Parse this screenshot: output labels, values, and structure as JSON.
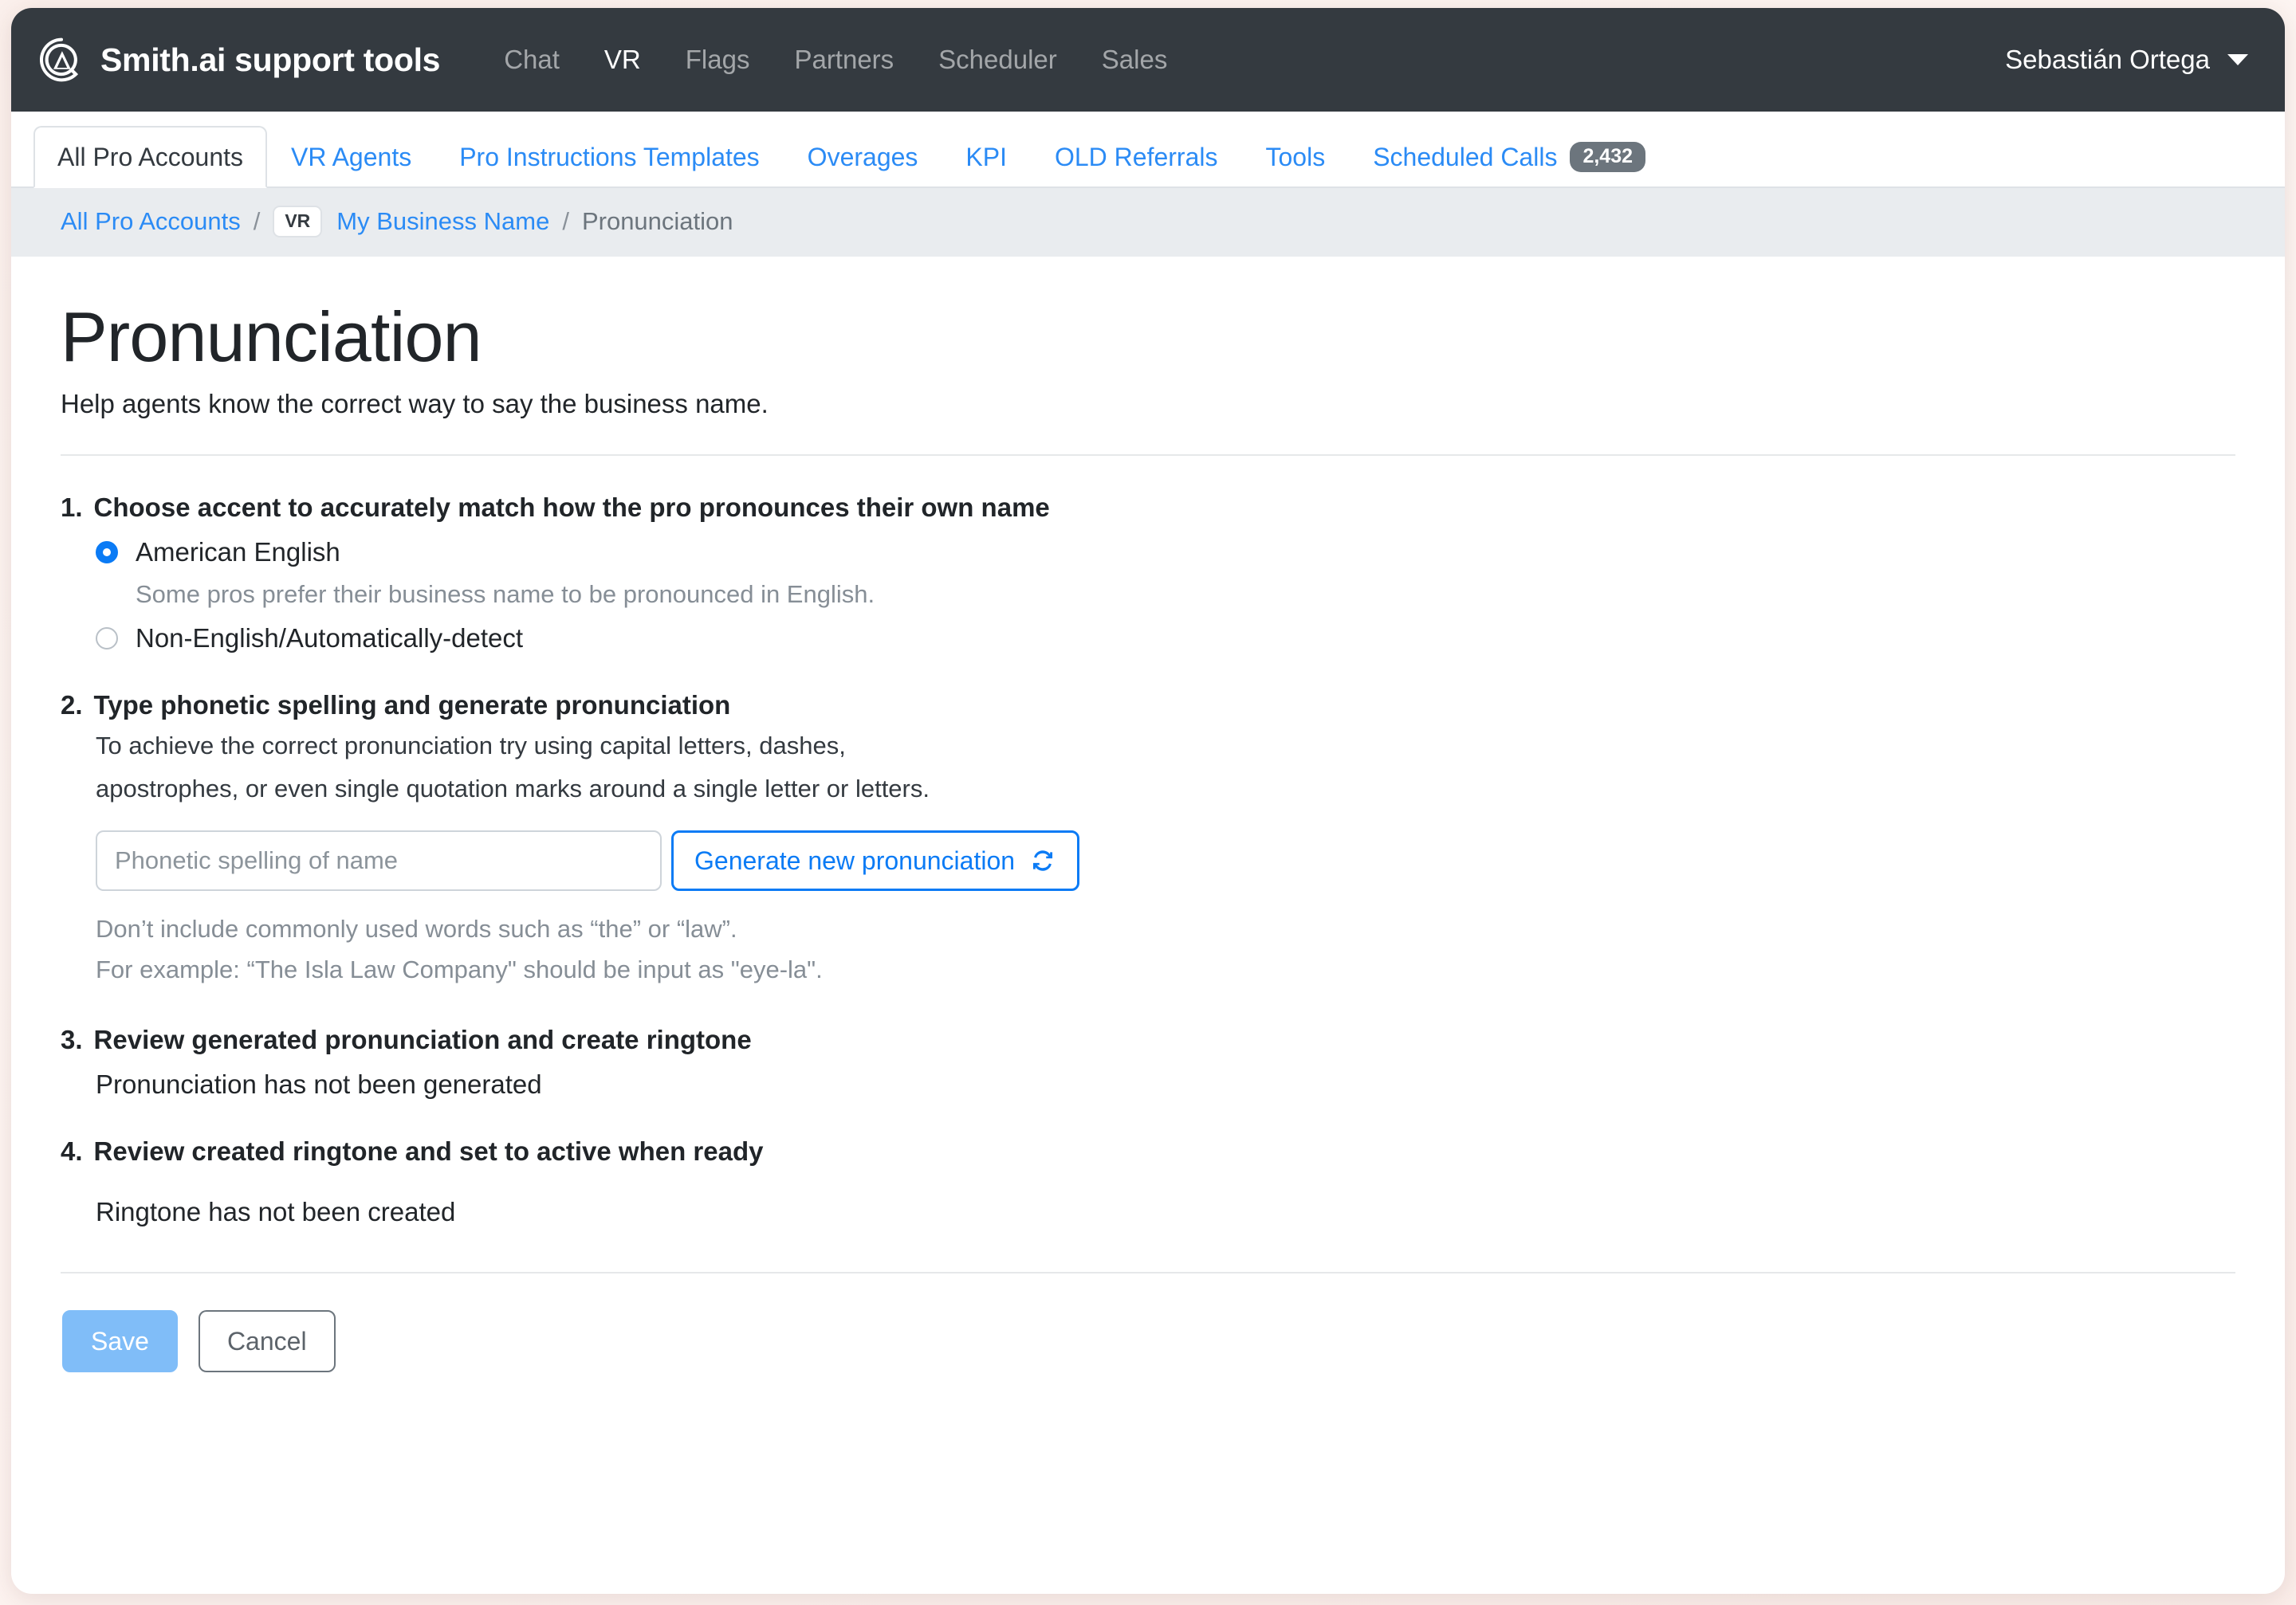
{
  "navbar": {
    "brand": "Smith.ai support tools",
    "logo_icon": "smith-ai-logo-icon",
    "links": [
      {
        "label": "Chat",
        "active": false
      },
      {
        "label": "VR",
        "active": true
      },
      {
        "label": "Flags",
        "active": false
      },
      {
        "label": "Partners",
        "active": false
      },
      {
        "label": "Scheduler",
        "active": false
      },
      {
        "label": "Sales",
        "active": false
      }
    ],
    "user": "Sebastián Ortega",
    "caret_icon": "chevron-down-icon"
  },
  "tabs": [
    {
      "label": "All Pro Accounts",
      "active": true,
      "badge": ""
    },
    {
      "label": "VR Agents",
      "active": false,
      "badge": ""
    },
    {
      "label": "Pro Instructions Templates",
      "active": false,
      "badge": ""
    },
    {
      "label": "Overages",
      "active": false,
      "badge": ""
    },
    {
      "label": "KPI",
      "active": false,
      "badge": ""
    },
    {
      "label": "OLD Referrals",
      "active": false,
      "badge": ""
    },
    {
      "label": "Tools",
      "active": false,
      "badge": ""
    },
    {
      "label": "Scheduled Calls",
      "active": false,
      "badge": "2,432"
    }
  ],
  "breadcrumb": {
    "root": "All Pro Accounts",
    "sep": "/",
    "chip": "VR",
    "business": "My Business Name",
    "current": "Pronunciation"
  },
  "page": {
    "title": "Pronunciation",
    "subtitle": "Help agents know the correct way to say the business name."
  },
  "steps": {
    "one": {
      "num": "1.",
      "title": "Choose accent to accurately match how the pro pronounces their own name",
      "options": [
        {
          "label": "American English",
          "selected": true,
          "help": "Some pros prefer their business name to be pronounced in English."
        },
        {
          "label": "Non-English/Automatically-detect",
          "selected": false,
          "help": ""
        }
      ]
    },
    "two": {
      "num": "2.",
      "title": "Type phonetic spelling and generate pronunciation",
      "body_line1": "To achieve the correct pronunciation try using capital letters, dashes,",
      "body_line2": "apostrophes, or even single quotation marks around a single letter or letters.",
      "input_placeholder": "Phonetic spelling of name",
      "input_value": "",
      "generate_label": "Generate new pronunciation",
      "generate_icon": "sync-refresh-icon",
      "hint_line1": "Don’t include commonly used words such as “the” or “law”.",
      "hint_line2": "For example: “The Isla Law Company\" should be input as \"eye-la\"."
    },
    "three": {
      "num": "3.",
      "title": "Review generated pronunciation and create ringtone",
      "status": "Pronunciation has not been generated"
    },
    "four": {
      "num": "4.",
      "title": "Review created ringtone and set to active when ready",
      "status": "Ringtone has not been created"
    }
  },
  "actions": {
    "save_label": "Save",
    "cancel_label": "Cancel"
  },
  "colors": {
    "navbar_bg": "#343a40",
    "link_blue": "#2b8bf5",
    "accent_blue": "#0b7bf5",
    "breadcrumb_bg": "#e9ecef",
    "badge_gray": "#6c757d",
    "save_disabled": "#80bdf8"
  }
}
